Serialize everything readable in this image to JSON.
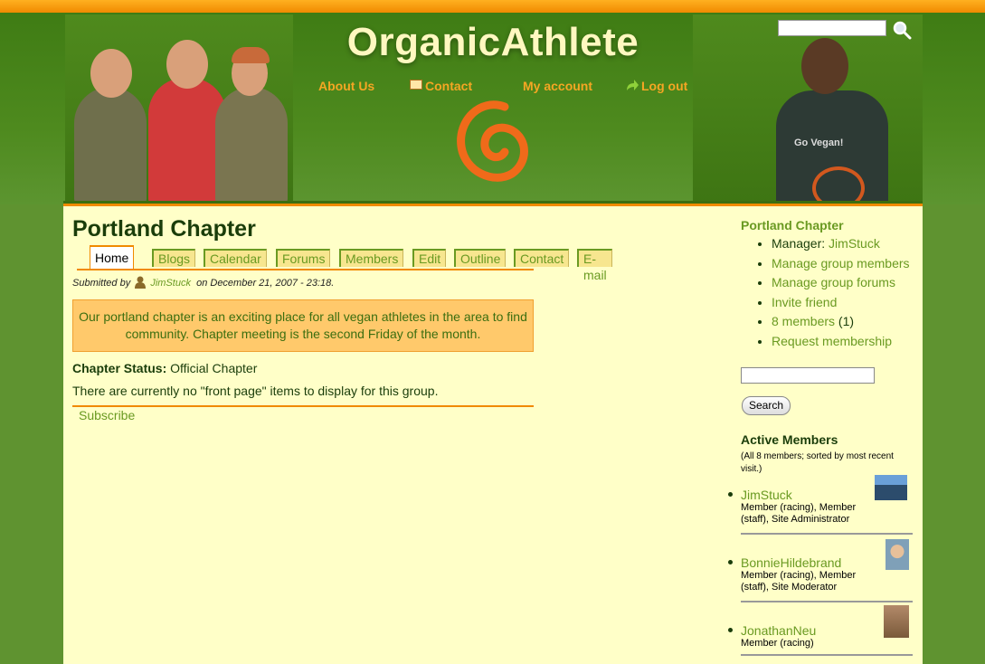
{
  "site": {
    "title": "OrganicAthlete"
  },
  "topnav": {
    "about": "About Us",
    "contact": "Contact",
    "account": "My account",
    "logout": "Log out"
  },
  "page": {
    "title": "Portland Chapter"
  },
  "tabs": [
    "Home",
    "Blogs",
    "Calendar",
    "Forums",
    "Members",
    "Edit",
    "Outline",
    "Contact",
    "E-mail"
  ],
  "submitted": {
    "prefix": "Submitted by",
    "user": "JimStuck",
    "suffix": "on December 21, 2007 - 23:18."
  },
  "callout": "Our portland chapter is an exciting place for all vegan athletes in the area to find community. Chapter meeting is the second Friday of the month.",
  "status": {
    "label": "Chapter Status:",
    "value": "Official Chapter"
  },
  "nofront": "There are currently no \"front page\" items to display for this group.",
  "subscribe": "Subscribe",
  "sidebar": {
    "title": "Portland Chapter",
    "manager_label": "Manager:",
    "manager": "JimStuck",
    "links": [
      "Manage group members",
      "Manage group forums",
      "Invite friend"
    ],
    "members_link": "8 members",
    "members_count": "(1)",
    "request": "Request membership",
    "search_button": "Search",
    "active_title": "Active Members",
    "active_sub": "(All 8 members; sorted by most recent visit.)",
    "members": [
      {
        "name": "JimStuck",
        "roles": "Member (racing), Member (staff), Site Administrator"
      },
      {
        "name": "BonnieHildebrand",
        "roles": "Member (racing), Member (staff), Site Moderator"
      },
      {
        "name": "JonathanNeu",
        "roles": "Member (racing)"
      }
    ]
  },
  "photo_right_shirt": "Go Vegan!",
  "colors": {
    "accent": "#f08a00",
    "link": "#6a9a22",
    "background": "#5f9330",
    "content": "#ffffc8"
  }
}
